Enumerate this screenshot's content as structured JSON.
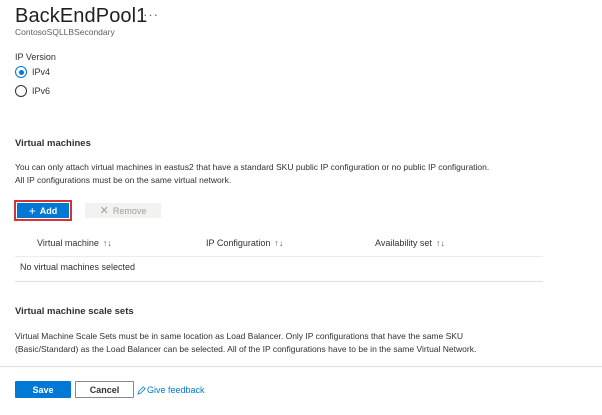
{
  "header": {
    "title": "BackEndPool1",
    "more_label": "···",
    "subtitle": "ContosoSQLLBSecondary"
  },
  "ip_version": {
    "label": "IP Version",
    "options": [
      {
        "label": "IPv4",
        "selected": true
      },
      {
        "label": "IPv6",
        "selected": false
      }
    ]
  },
  "virtual_machines": {
    "heading": "Virtual machines",
    "description_lines": [
      "You can only attach virtual machines in eastus2 that have a standard SKU public IP configuration or no public IP configuration.",
      "All IP configurations must be on the same virtual network."
    ],
    "add_label": "Add",
    "add_icon": "plus-icon",
    "remove_label": "Remove",
    "remove_icon": "close-icon",
    "columns": [
      "Virtual machine",
      "IP Configuration",
      "Availability set"
    ],
    "sort_glyph": "↑↓",
    "empty_text": "No virtual machines selected"
  },
  "scale_sets": {
    "heading": "Virtual machine scale sets",
    "description_lines": [
      "Virtual Machine Scale Sets must be in same location as Load Balancer. Only IP configurations that have the same SKU",
      "(Basic/Standard) as the Load Balancer can be selected. All of the IP configurations have to be in the same Virtual Network."
    ]
  },
  "footer": {
    "save_label": "Save",
    "cancel_label": "Cancel",
    "feedback_label": "Give feedback",
    "feedback_icon": "feedback-icon"
  },
  "colors": {
    "accent": "#0078d4",
    "highlight": "#d13438"
  }
}
